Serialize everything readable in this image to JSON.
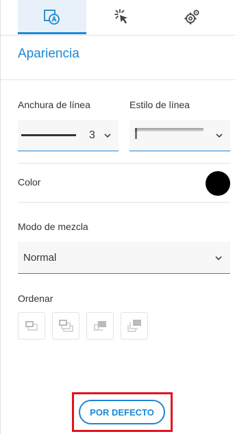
{
  "tabs": [
    {
      "name": "appearance",
      "icon": "appearance-icon",
      "active": true
    },
    {
      "name": "interaction",
      "icon": "cursor-click-icon",
      "active": false
    },
    {
      "name": "settings",
      "icon": "settings-gear-icon",
      "active": false
    }
  ],
  "panel": {
    "title": "Apariencia",
    "line_width": {
      "label": "Anchura de línea",
      "value": "3"
    },
    "line_style": {
      "label": "Estilo de línea"
    },
    "color": {
      "label": "Color",
      "value": "#000000"
    },
    "blend_mode": {
      "label": "Modo de mezcla",
      "value": "Normal"
    },
    "order": {
      "label": "Ordenar",
      "buttons": [
        "bring-forward-icon",
        "bring-to-front-icon",
        "send-backward-icon",
        "send-to-back-icon"
      ]
    },
    "default_button": "POR DEFECTO"
  },
  "colors": {
    "accent": "#1b87d3",
    "highlight": "#e3121b"
  }
}
